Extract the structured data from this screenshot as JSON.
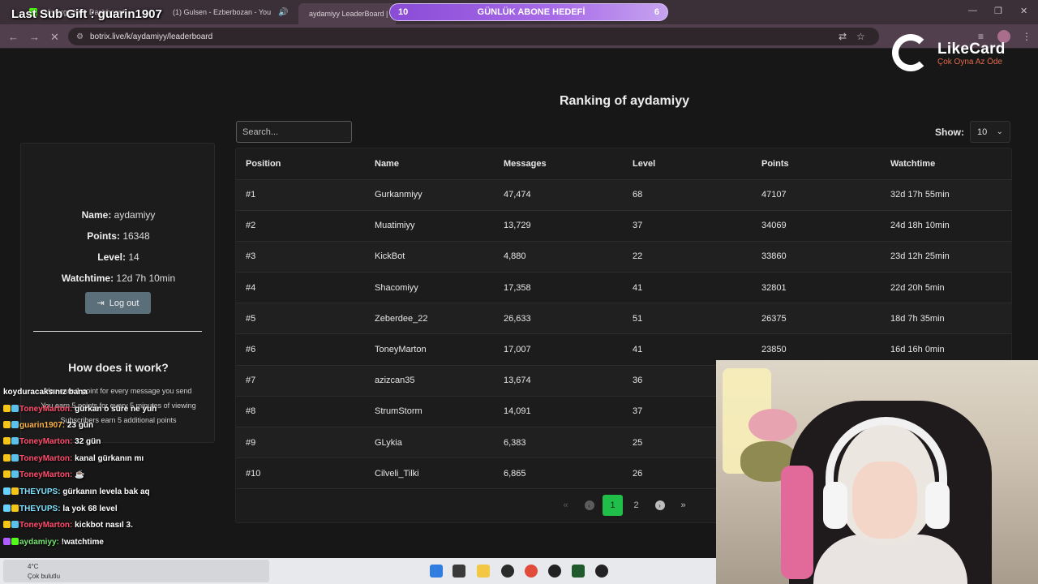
{
  "browser": {
    "tabs": [
      {
        "label": "Gösterge Kick Dashboard"
      },
      {
        "label": "(1) Gulsen - Ezberbozan - You"
      },
      {
        "label": "aydamiyy LeaderBoard | T"
      }
    ],
    "url": "botrix.live/k/aydamiyy/leaderboard"
  },
  "overlay": {
    "last_sub": "Last Sub Gift : guarin1907",
    "goal_left": "10",
    "goal_label": "GÜNLÜK ABONE HEDEFİ",
    "goal_right": "6",
    "logo_name": "LikeCard",
    "logo_tagline": "Çok Oyna  Az Öde"
  },
  "page": {
    "title": "Ranking of aydamiyy",
    "search_placeholder": "Search...",
    "show_label": "Show:",
    "show_value": "10"
  },
  "profile": {
    "name_label": "Name:",
    "name": "aydamiyy",
    "points_label": "Points:",
    "points": "16348",
    "level_label": "Level:",
    "level": "14",
    "watch_label": "Watchtime:",
    "watchtime": "12d 7h 10min",
    "logout": "Log out",
    "how_title": "How does it work?",
    "rules": [
      "You earn 1 point for every message you send",
      "You earn 5 points for every 5 minutes of viewing",
      "Subscribers earn 5 additional points"
    ]
  },
  "table": {
    "headers": [
      "Position",
      "Name",
      "Messages",
      "Level",
      "Points",
      "Watchtime"
    ],
    "rows": [
      [
        "#1",
        "Gurkanmiyy",
        "47,474",
        "68",
        "47107",
        "32d 17h 55min"
      ],
      [
        "#2",
        "Muatimiyy",
        "13,729",
        "37",
        "34069",
        "24d 18h 10min"
      ],
      [
        "#3",
        "KickBot",
        "4,880",
        "22",
        "33860",
        "23d 12h 25min"
      ],
      [
        "#4",
        "Shacomiyy",
        "17,358",
        "41",
        "32801",
        "22d 20h 5min"
      ],
      [
        "#5",
        "Zeberdee_22",
        "26,633",
        "51",
        "26375",
        "18d 7h 35min"
      ],
      [
        "#6",
        "ToneyMarton",
        "17,007",
        "41",
        "23850",
        "16d 16h 0min"
      ],
      [
        "#7",
        "azizcan35",
        "13,674",
        "36",
        "",
        ""
      ],
      [
        "#8",
        "StrumStorm",
        "14,091",
        "37",
        "",
        ""
      ],
      [
        "#9",
        "GLykia",
        "6,383",
        "25",
        "",
        ""
      ],
      [
        "#10",
        "Cilveli_Tilki",
        "6,865",
        "26",
        "",
        ""
      ]
    ]
  },
  "pagination": {
    "pages": [
      "1",
      "2"
    ],
    "current": "1"
  },
  "chat": [
    {
      "user": "",
      "text": "koyduracaksınız bana"
    },
    {
      "user": "ToneyMarton:",
      "text": "gürkan o süre ne yuh",
      "cls": "user-red"
    },
    {
      "user": "guarin1907:",
      "text": "23 gün",
      "cls": "user-orange"
    },
    {
      "user": "ToneyMarton:",
      "text": "32 gün",
      "cls": "user-red"
    },
    {
      "user": "ToneyMarton:",
      "text": "kanal gürkanın mı",
      "cls": "user-red"
    },
    {
      "user": "ToneyMarton:",
      "text": "",
      "cls": "user-red"
    },
    {
      "user": "THEYUPS:",
      "text": "gürkanın levela bak aq",
      "cls": "user-cyan"
    },
    {
      "user": "THEYUPS:",
      "text": "la yok 68 level",
      "cls": "user-cyan"
    },
    {
      "user": "ToneyMarton:",
      "text": "kickbot nasıl 3.",
      "cls": "user-red"
    },
    {
      "user": "aydamiyy:",
      "text": "!watchtime",
      "cls": "user-green"
    }
  ],
  "weather": {
    "temp": "4°C",
    "desc": "Çok bulutlu"
  },
  "colors": {
    "accent_green": "#1fbf4a",
    "goal_purple": "#8a4bd6",
    "logout_btn": "#5b6f7b"
  }
}
